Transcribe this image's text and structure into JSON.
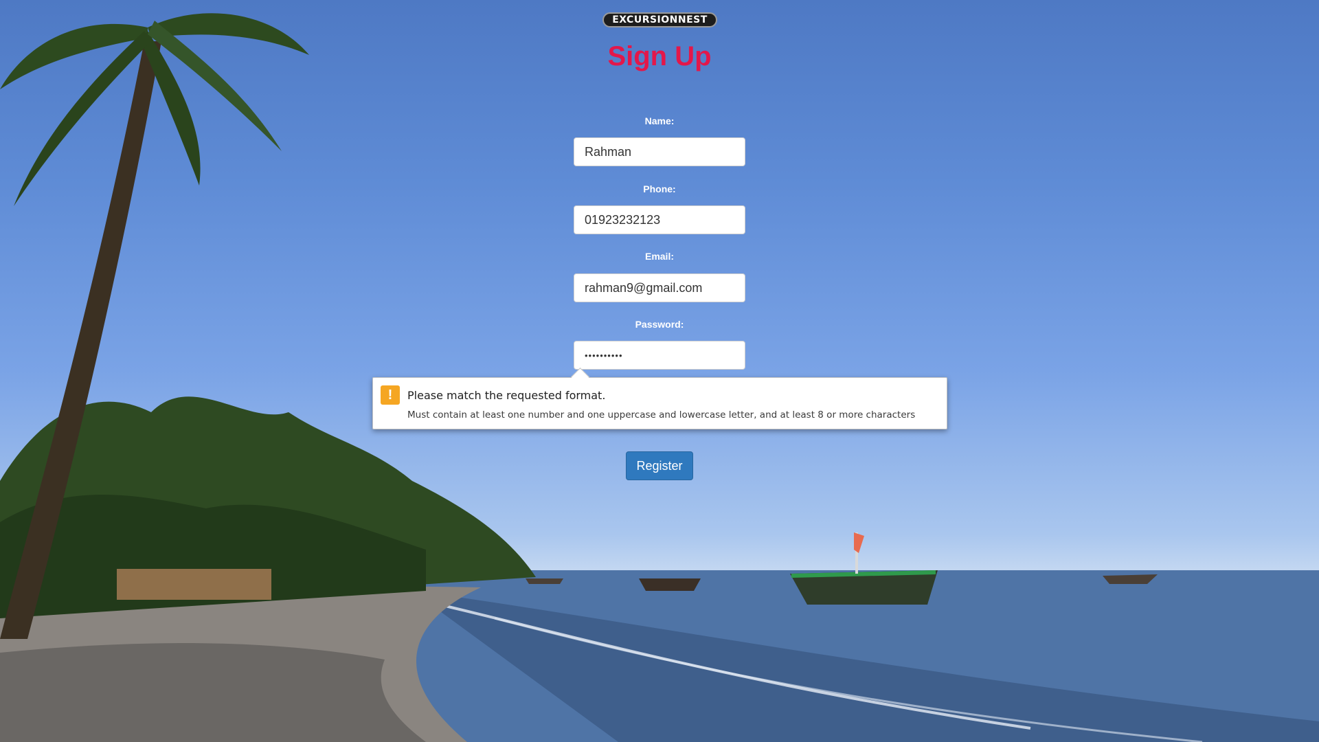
{
  "brand": {
    "logo_text": "EXCURSIONNEST"
  },
  "form": {
    "title": "Sign Up",
    "fields": [
      {
        "label": "Name:",
        "value": "Rahman"
      },
      {
        "label": "Phone:",
        "value": "01923232123"
      },
      {
        "label": "Email:",
        "value": "rahman9@gmail.com"
      },
      {
        "label": "Password:",
        "value": "••••••••••"
      }
    ],
    "submit_label": "Register"
  },
  "validation_tooltip": {
    "icon": "warning-icon",
    "icon_glyph": "!",
    "message": "Please match the requested format.",
    "detail": "Must contain at least one number and one uppercase and lowercase letter, and at least 8 or more characters"
  },
  "colors": {
    "title": "#e3174a",
    "button": "#2f79be",
    "warning": "#f5a623"
  }
}
